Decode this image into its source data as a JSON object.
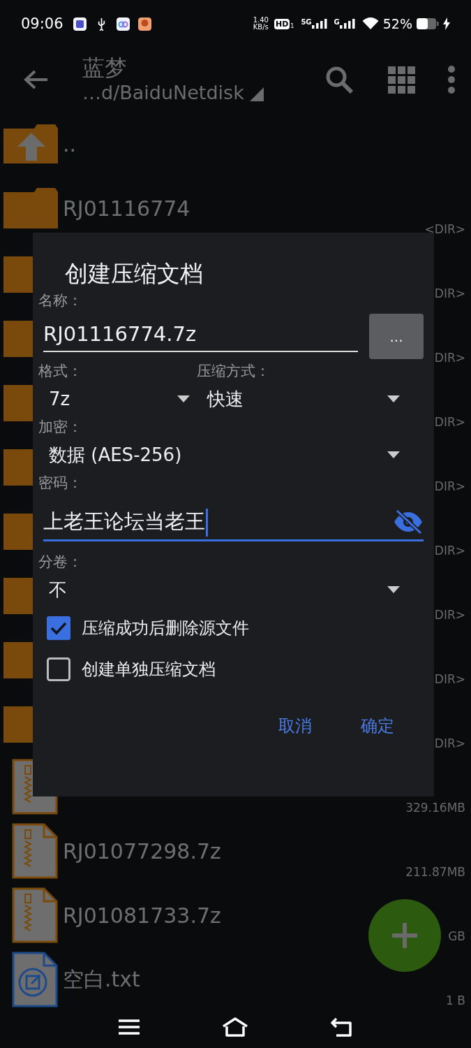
{
  "status_bar": {
    "time": "09:06",
    "net_speed": "1.40",
    "net_unit": "KB/s",
    "hd": "HD",
    "hd_sub": "1",
    "sim1": "5G",
    "sim2": "G",
    "battery": "52%"
  },
  "app_bar": {
    "title": "蓝梦",
    "path": "…d/BaiduNetdisk"
  },
  "files": [
    {
      "kind": "up",
      "name": ".."
    },
    {
      "kind": "folder",
      "name": "RJ01116774",
      "size": "<DIR>"
    },
    {
      "kind": "folder",
      "size": "DIR>"
    },
    {
      "kind": "folder",
      "size": "DIR>"
    },
    {
      "kind": "folder",
      "size": "DIR>"
    },
    {
      "kind": "folder",
      "size": "DIR>"
    },
    {
      "kind": "folder",
      "size": "DIR>"
    },
    {
      "kind": "folder",
      "size": "DIR>"
    },
    {
      "kind": "folder",
      "size": "DIR>"
    },
    {
      "kind": "folder",
      "size": "DIR>"
    },
    {
      "kind": "archive",
      "size": "329.16MB"
    },
    {
      "kind": "archive",
      "name": "RJ01077298.7z",
      "size": "211.87MB"
    },
    {
      "kind": "archive",
      "name": "RJ01081733.7z",
      "size": "GB"
    },
    {
      "kind": "text",
      "name": "空白.txt",
      "size": "1 B"
    }
  ],
  "dialog": {
    "title": "创建压缩文档",
    "name_label": "名称：",
    "name_value": "RJ01116774.7z",
    "browse_button": "...",
    "format_label": "格式：",
    "format_value": "7z",
    "method_label": "压缩方式：",
    "method_value": "快速",
    "encryption_label": "加密：",
    "encryption_value": "数据 (AES-256)",
    "password_label": "密码：",
    "password_value": "上老王论坛当老王",
    "password_focused": true,
    "split_label": "分卷：",
    "split_value": "不",
    "options": [
      {
        "label": "压缩成功后删除源文件",
        "checked": true
      },
      {
        "label": "创建单独压缩文档",
        "checked": false
      }
    ],
    "buttons": [
      "取消",
      "确定"
    ]
  }
}
